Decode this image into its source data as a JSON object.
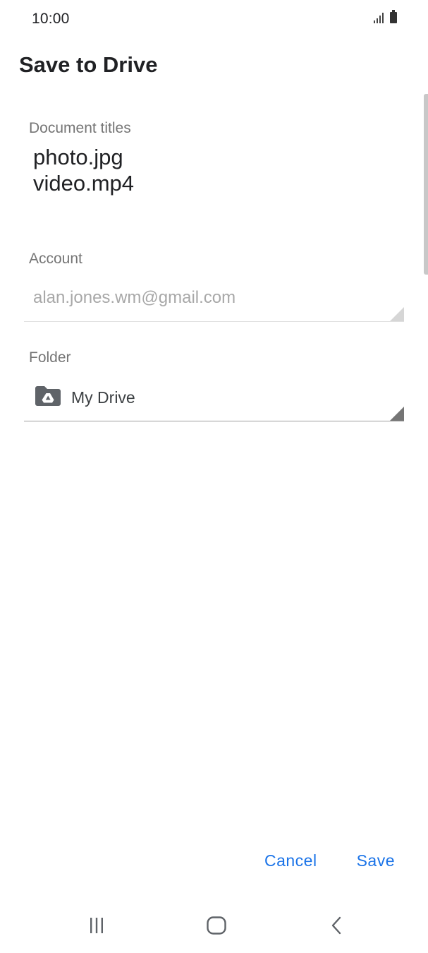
{
  "status_bar": {
    "time": "10:00",
    "icons": [
      "signal-icon",
      "battery-icon"
    ]
  },
  "dialog": {
    "title": "Save to Drive",
    "document_titles": {
      "label": "Document titles",
      "items": [
        "photo.jpg",
        "video.mp4"
      ]
    },
    "account": {
      "label": "Account",
      "value": "alan.jones.wm@gmail.com"
    },
    "folder": {
      "label": "Folder",
      "value": "My Drive",
      "icon": "drive-folder-icon"
    },
    "actions": {
      "cancel_label": "Cancel",
      "save_label": "Save"
    }
  },
  "nav_bar": {
    "buttons": [
      "recents-icon",
      "home-icon",
      "back-icon"
    ]
  },
  "colors": {
    "accent": "#1a73e8",
    "label": "#757575",
    "disabled_text": "#a8a8a8",
    "text": "#202124"
  }
}
